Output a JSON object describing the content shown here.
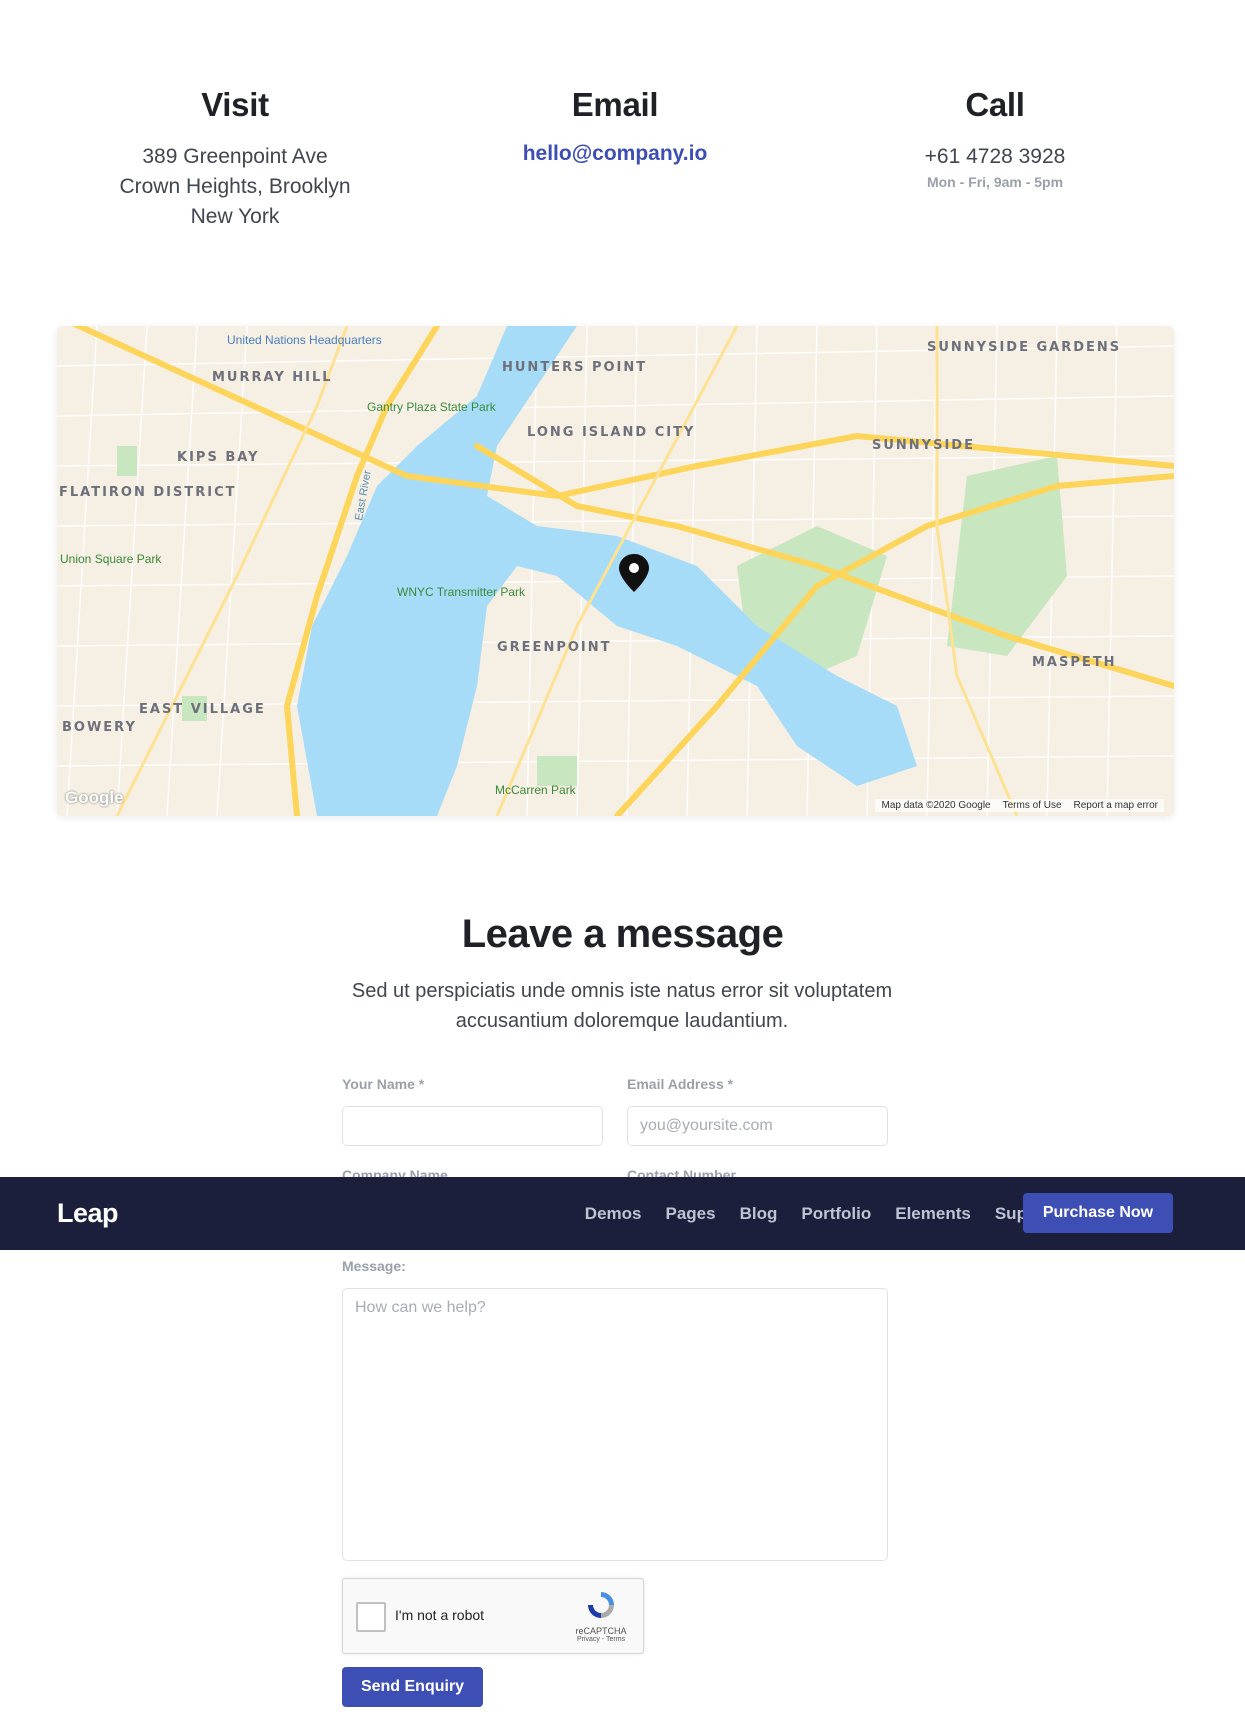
{
  "contact": {
    "visit": {
      "title": "Visit",
      "lines": [
        "389 Greenpoint Ave",
        "Crown Heights, Brooklyn",
        "New York"
      ]
    },
    "email": {
      "title": "Email",
      "address": "hello@company.io"
    },
    "call": {
      "title": "Call",
      "phone": "+61 4728 3928",
      "hours": "Mon - Fri, 9am - 5pm"
    }
  },
  "map": {
    "labels": {
      "hunters_point": "HUNTERS POINT",
      "long_island_city": "LONG ISLAND CITY",
      "murray_hill": "MURRAY HILL",
      "kips_bay": "KIPS BAY",
      "flatiron": "FLATIRON DISTRICT",
      "sunnyside_gardens": "SUNNYSIDE GARDENS",
      "sunnyside": "SUNNYSIDE",
      "greenpoint": "GREENPOINT",
      "maspeth": "MASPETH",
      "east_village": "EAST VILLAGE",
      "bowery": "BOWERY",
      "union_square": "Union Square Park",
      "un_hq": "United Nations Headquarters",
      "gantry": "Gantry Plaza State Park",
      "wnyc": "WNYC Transmitter Park",
      "mccarren": "McCarren Park",
      "east_river": "East River"
    },
    "footer": {
      "data": "Map data ©2020 Google",
      "terms": "Terms of Use",
      "report": "Report a map error"
    },
    "logo": "Google"
  },
  "message": {
    "title": "Leave a message",
    "subtitle": "Sed ut perspiciatis unde omnis iste natus error sit voluptatem accusantium doloremque laudantium."
  },
  "form": {
    "name_label": "Your Name *",
    "email_label": "Email Address *",
    "email_placeholder": "you@yoursite.com",
    "company_label": "Company Name",
    "contact_label": "Contact Number",
    "message_label": "Message:",
    "message_placeholder": "How can we help?",
    "captcha_text": "I'm not a robot",
    "captcha_brand": "reCAPTCHA",
    "captcha_links": "Privacy - Terms",
    "send_label": "Send Enquiry"
  },
  "nav": {
    "brand": "Leap",
    "links": [
      "Demos",
      "Pages",
      "Blog",
      "Portfolio",
      "Elements",
      "Support"
    ],
    "cta": "Purchase Now"
  },
  "colors": {
    "accent": "#3d4fb4",
    "navbar": "#1b1f3b"
  }
}
